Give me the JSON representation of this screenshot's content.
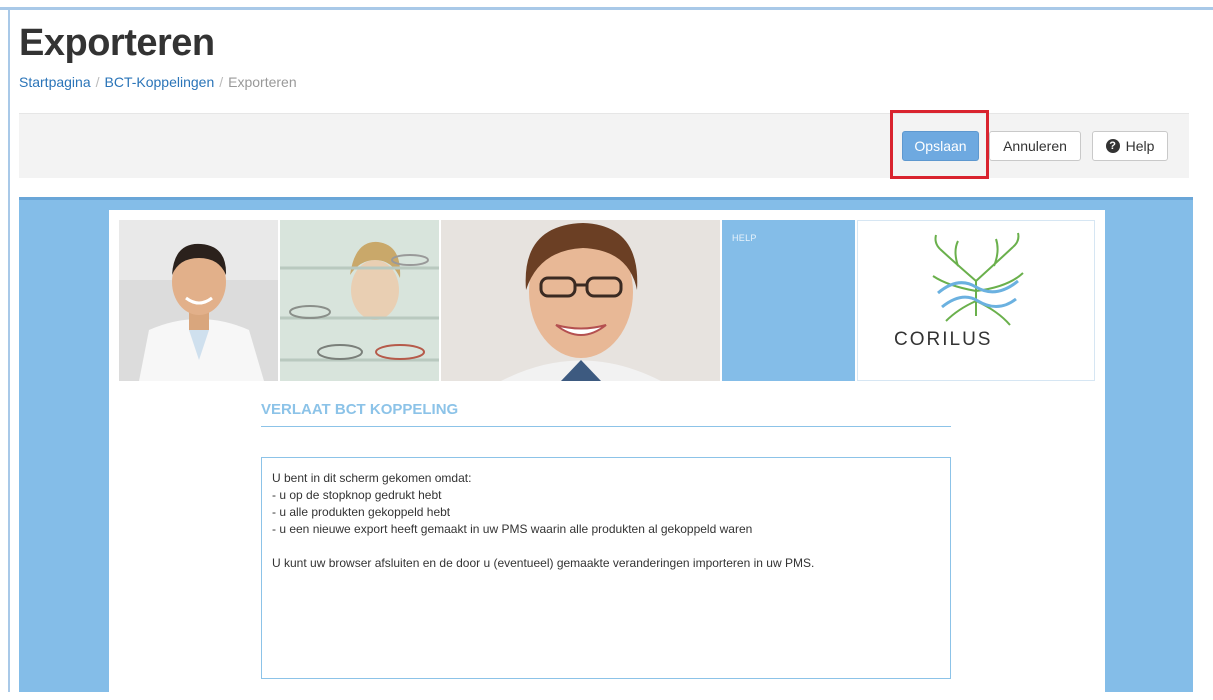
{
  "page": {
    "title": "Exporteren"
  },
  "breadcrumb": {
    "items": [
      "Startpagina",
      "BCT-Koppelingen",
      "Exporteren"
    ],
    "separator": "/"
  },
  "toolbar": {
    "save_label": "Opslaan",
    "cancel_label": "Annuleren",
    "help_label": "Help",
    "help_icon": "question-circle-icon",
    "highlight_color": "#d9232e"
  },
  "banner": {
    "help_tile_label": "HELP",
    "logo_text": "CORILUS"
  },
  "message": {
    "title": "VERLAAT BCT KOPPELING",
    "lines": [
      "U bent in dit scherm gekomen omdat:",
      "- u op de stopknop gedrukt hebt",
      "- u alle produkten gekoppeld hebt",
      "- u een nieuwe export heeft gemaakt in uw PMS waarin alle produkten al gekoppeld waren",
      "",
      "U kunt uw browser afsluiten en de door u (eventueel) gemaakte veranderingen importeren in uw PMS."
    ]
  },
  "colors": {
    "accent_blue": "#84bde8",
    "primary_button": "#6ea9e0",
    "link": "#2a74b8"
  }
}
